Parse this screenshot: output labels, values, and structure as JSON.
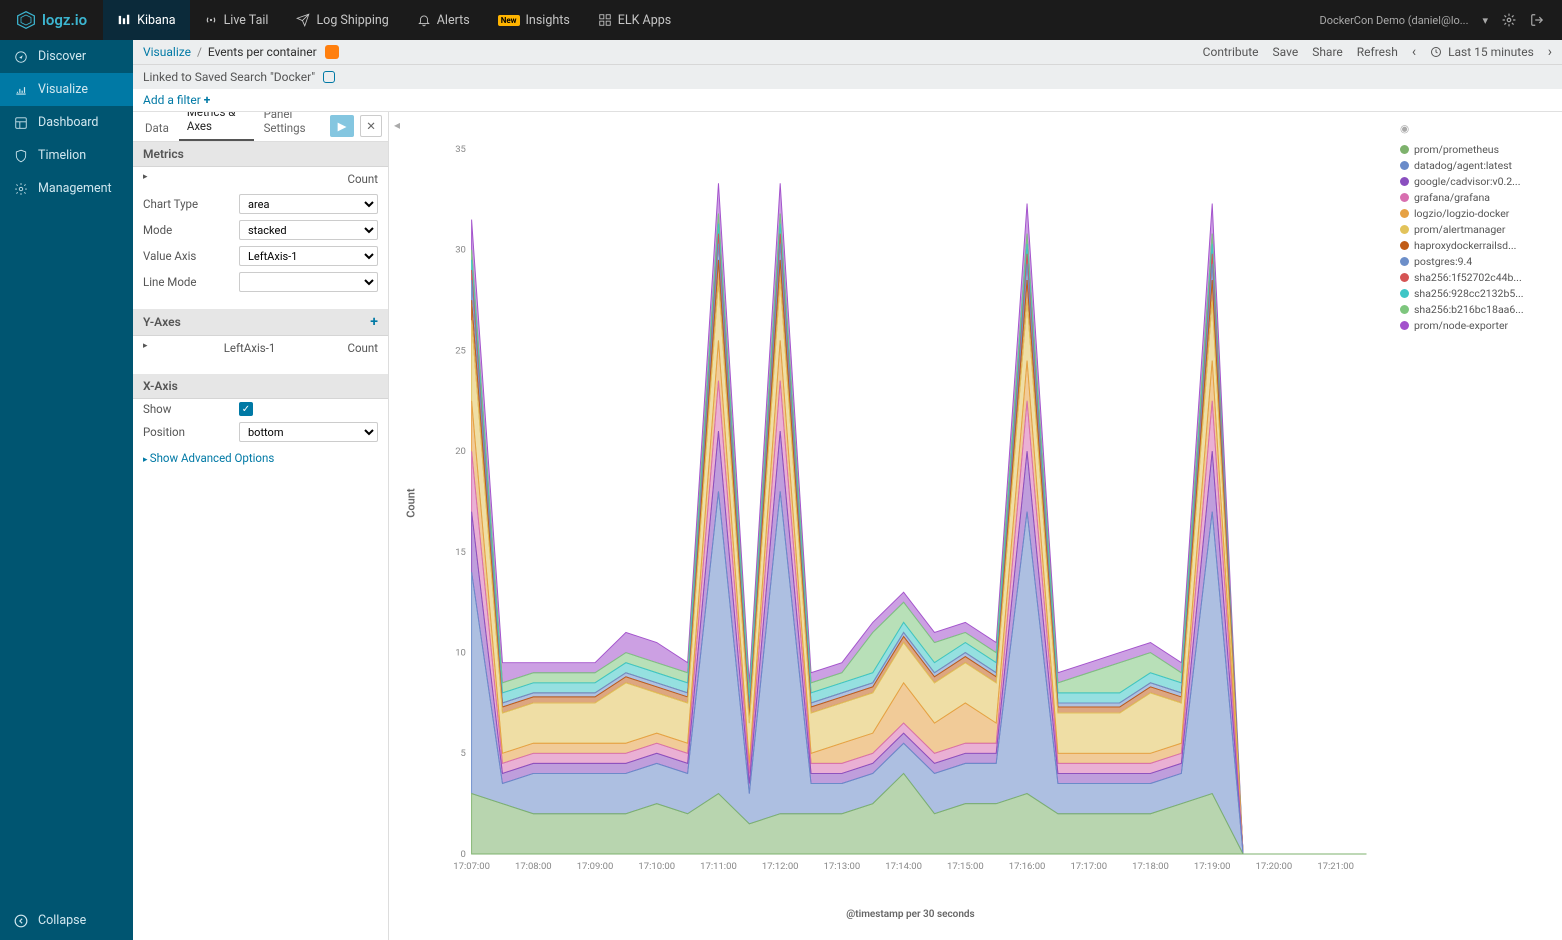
{
  "brand": "logz.io",
  "topnav": [
    {
      "label": "Kibana",
      "icon": "bars"
    },
    {
      "label": "Live Tail",
      "icon": "radio"
    },
    {
      "label": "Log Shipping",
      "icon": "plane"
    },
    {
      "label": "Alerts",
      "icon": "bell"
    },
    {
      "label": "Insights",
      "icon": "bulb",
      "badge": "New"
    },
    {
      "label": "ELK Apps",
      "icon": "grid"
    }
  ],
  "account": "DockerCon Demo (daniel@lo...",
  "sidenav": [
    {
      "label": "Discover",
      "icon": "compass"
    },
    {
      "label": "Visualize",
      "icon": "chart"
    },
    {
      "label": "Dashboard",
      "icon": "dash"
    },
    {
      "label": "Timelion",
      "icon": "shield"
    },
    {
      "label": "Management",
      "icon": "gear"
    }
  ],
  "collapse_label": "Collapse",
  "breadcrumb": {
    "root": "Visualize",
    "page": "Events per container"
  },
  "actions": [
    "Contribute",
    "Save",
    "Share",
    "Refresh"
  ],
  "timepicker": "Last 15 minutes",
  "linked_search": "Linked to Saved Search \"Docker\"",
  "filter": {
    "add": "Add a filter",
    "plus": "+"
  },
  "tabs": [
    "Data",
    "Metrics & Axes",
    "Panel Settings"
  ],
  "panel": {
    "metrics_header": "Metrics",
    "metric_row": "Count",
    "chart_type": {
      "label": "Chart Type",
      "value": "area"
    },
    "mode": {
      "label": "Mode",
      "value": "stacked"
    },
    "value_axis": {
      "label": "Value Axis",
      "value": "LeftAxis-1"
    },
    "line_mode": {
      "label": "Line Mode",
      "value": ""
    },
    "yaxes_header": "Y-Axes",
    "yaxis_row": {
      "name": "LeftAxis-1",
      "metric": "Count"
    },
    "xaxis_header": "X-Axis",
    "show": {
      "label": "Show",
      "checked": true
    },
    "position": {
      "label": "Position",
      "value": "bottom"
    },
    "advanced": "Show Advanced Options"
  },
  "chart_data": {
    "type": "area",
    "stacked": true,
    "ylabel": "Count",
    "xlabel": "@timestamp per 30 seconds",
    "ylim": [
      0,
      35
    ],
    "y_ticks": [
      0,
      5,
      10,
      15,
      20,
      25,
      30,
      35
    ],
    "x_ticks": [
      "17:07:00",
      "17:08:00",
      "17:09:00",
      "17:10:00",
      "17:11:00",
      "17:12:00",
      "17:13:00",
      "17:14:00",
      "17:15:00",
      "17:16:00",
      "17:17:00",
      "17:18:00",
      "17:19:00",
      "17:20:00",
      "17:21:00"
    ],
    "categories": [
      "17:07:00",
      "17:07:30",
      "17:08:00",
      "17:08:30",
      "17:09:00",
      "17:09:30",
      "17:10:00",
      "17:10:30",
      "17:11:00",
      "17:11:30",
      "17:12:00",
      "17:12:30",
      "17:13:00",
      "17:13:30",
      "17:14:00",
      "17:14:30",
      "17:15:00",
      "17:15:30",
      "17:16:00",
      "17:16:30",
      "17:17:00",
      "17:17:30",
      "17:18:00",
      "17:18:30",
      "17:19:00",
      "17:19:30",
      "17:20:00",
      "17:20:30",
      "17:21:00",
      "17:21:30"
    ],
    "series": [
      {
        "name": "prom/prometheus",
        "color": "#7eb26d",
        "values": [
          3,
          2.5,
          2,
          2,
          2,
          2,
          2.5,
          2,
          3,
          1.5,
          2,
          2,
          2,
          2.5,
          4,
          2,
          2.5,
          2.5,
          3,
          2,
          2,
          2,
          2,
          2.5,
          3,
          0,
          0,
          0,
          0,
          0
        ]
      },
      {
        "name": "datadog/agent:latest",
        "color": "#6a8bc9",
        "values": [
          11,
          1,
          2,
          2,
          2,
          2,
          2,
          2,
          15,
          1.5,
          16,
          1.5,
          1.5,
          1.5,
          1.5,
          2,
          2,
          2,
          14,
          1.5,
          1.5,
          1.5,
          1.5,
          1.5,
          14,
          0,
          0,
          0,
          0,
          0
        ]
      },
      {
        "name": "google/cadvisor:v0.2...",
        "color": "#8a4fbf",
        "values": [
          3,
          0.5,
          0.5,
          0.5,
          0.5,
          0.5,
          0.5,
          0.5,
          3,
          0.5,
          3,
          0.5,
          0.5,
          0.5,
          0.5,
          0.5,
          0.5,
          0.5,
          3,
          0.5,
          0.5,
          0.5,
          0.5,
          0.5,
          3,
          0,
          0,
          0,
          0,
          0
        ]
      },
      {
        "name": "grafana/grafana",
        "color": "#d86fb0",
        "values": [
          3,
          0.5,
          0.5,
          0.5,
          0.5,
          0.5,
          0.5,
          0.5,
          2.5,
          0.5,
          2.5,
          0.5,
          0.5,
          0.5,
          0.5,
          0.5,
          0.5,
          0.5,
          2.5,
          0.5,
          0.5,
          0.5,
          0.5,
          0.5,
          2.5,
          0,
          0,
          0,
          0,
          0
        ]
      },
      {
        "name": "logzio/logzio-docker",
        "color": "#e6a144",
        "values": [
          2.5,
          0.5,
          0.5,
          0.5,
          0.5,
          0.5,
          0.5,
          0.5,
          2,
          0.5,
          2,
          0.5,
          1,
          1,
          2,
          1.5,
          2,
          1,
          2,
          0.5,
          0.5,
          0.5,
          0.5,
          0.5,
          2,
          0,
          0,
          0,
          0,
          0
        ]
      },
      {
        "name": "prom/alertmanager",
        "color": "#e2c35b",
        "values": [
          4,
          2,
          2,
          2,
          2,
          3,
          2,
          2,
          3,
          2,
          3,
          2,
          2,
          2,
          2,
          2,
          2,
          2,
          3,
          2,
          2,
          2,
          3,
          2,
          3,
          0,
          0,
          0,
          0,
          0
        ]
      },
      {
        "name": "haproxydockerrailsd...",
        "color": "#c15c17",
        "values": [
          1,
          0.3,
          0.3,
          0.3,
          0.3,
          0.3,
          0.3,
          0.3,
          1,
          0.3,
          1,
          0.3,
          0.3,
          0.3,
          0.3,
          0.3,
          0.3,
          0.3,
          1,
          0.3,
          0.3,
          0.3,
          0.3,
          0.3,
          1,
          0,
          0,
          0,
          0,
          0
        ]
      },
      {
        "name": "postgres:9.4",
        "color": "#6d8fc9",
        "values": [
          1,
          0.2,
          0.2,
          0.2,
          0.2,
          0.2,
          0.2,
          0.2,
          0.8,
          0.2,
          0.8,
          0.2,
          0.2,
          0.2,
          0.2,
          0.2,
          0.2,
          0.2,
          0.8,
          0.2,
          0.2,
          0.2,
          0.2,
          0.2,
          0.8,
          0,
          0,
          0,
          0,
          0
        ]
      },
      {
        "name": "sha256:1f52702c44b...",
        "color": "#d55454",
        "values": [
          0.5,
          0,
          0,
          0,
          0,
          0,
          0,
          0,
          0.5,
          0,
          0.5,
          0,
          0,
          0,
          0,
          0,
          0,
          0,
          0.5,
          0,
          0,
          0,
          0,
          0,
          0.5,
          0,
          0,
          0,
          0,
          0
        ]
      },
      {
        "name": "sha256:928cc2132b5...",
        "color": "#3ec6c6",
        "values": [
          0.5,
          0.5,
          0.5,
          0.5,
          0.5,
          0.5,
          0.5,
          0.5,
          0.5,
          0.5,
          0.5,
          0.5,
          0.5,
          0.5,
          0.5,
          0.5,
          0.5,
          0.5,
          0.5,
          0.5,
          0.5,
          0.5,
          0.5,
          0.5,
          0.5,
          0,
          0,
          0,
          0,
          0
        ]
      },
      {
        "name": "sha256:b216bc18aa6...",
        "color": "#7ec67e",
        "values": [
          0.5,
          0.5,
          0.5,
          0.5,
          0.5,
          0.5,
          0.5,
          0.5,
          0.5,
          0.5,
          0.5,
          0.5,
          0.5,
          2,
          1,
          1,
          0.5,
          0.5,
          0.5,
          0.5,
          1,
          1.5,
          1,
          0.5,
          0.5,
          0,
          0,
          0,
          0,
          0
        ]
      },
      {
        "name": "prom/node-exporter",
        "color": "#a352cc",
        "values": [
          1.5,
          1,
          0.5,
          0.5,
          0.5,
          1,
          1,
          0.5,
          1.5,
          0.5,
          1.5,
          0.5,
          0.5,
          0.5,
          0.5,
          0.5,
          0.5,
          0.5,
          1.5,
          0.5,
          0.5,
          0.5,
          0.5,
          0.5,
          1.5,
          0,
          0,
          0,
          0,
          0
        ]
      }
    ]
  }
}
